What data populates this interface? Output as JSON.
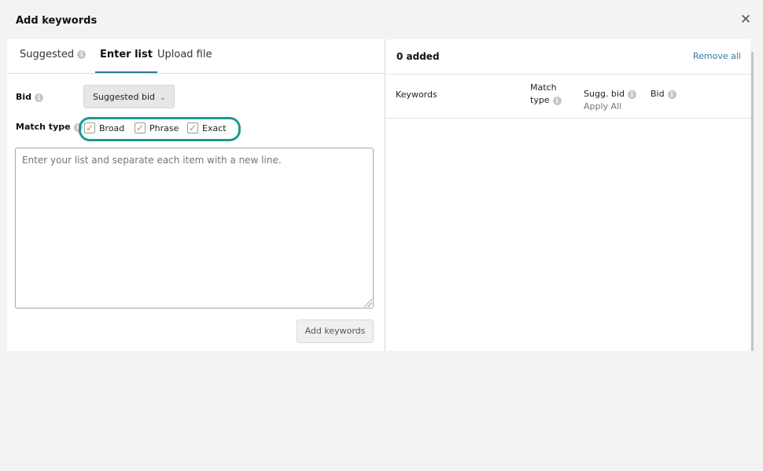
{
  "dialog": {
    "title": "Add keywords",
    "close_icon": "close-icon"
  },
  "tabs": [
    {
      "label": "Suggested",
      "active": false,
      "icon": "info-icon"
    },
    {
      "label": "Enter list",
      "active": true
    },
    {
      "label": "Upload file",
      "active": false
    }
  ],
  "form": {
    "bid_label": "Bid",
    "bid_select_value": "Suggested bid",
    "match_type_label": "Match type",
    "match_types": [
      {
        "label": "Broad",
        "checked": true
      },
      {
        "label": "Phrase",
        "checked": true
      },
      {
        "label": "Exact",
        "checked": true
      }
    ],
    "list_placeholder": "Enter your list and separate each item with a new line.",
    "add_button": "Add keywords"
  },
  "added": {
    "count_text": "0 added",
    "remove_all": "Remove all",
    "columns": {
      "keywords": "Keywords",
      "match_line1": "Match",
      "match_line2": "type",
      "sugg_bid": "Sugg. bid",
      "apply_all": "Apply All",
      "bid": "Bid"
    }
  },
  "colors": {
    "accent_link": "#2f7aa0",
    "highlight_ring": "#1c9a8f",
    "checkbox_check": "#e08a1a"
  }
}
